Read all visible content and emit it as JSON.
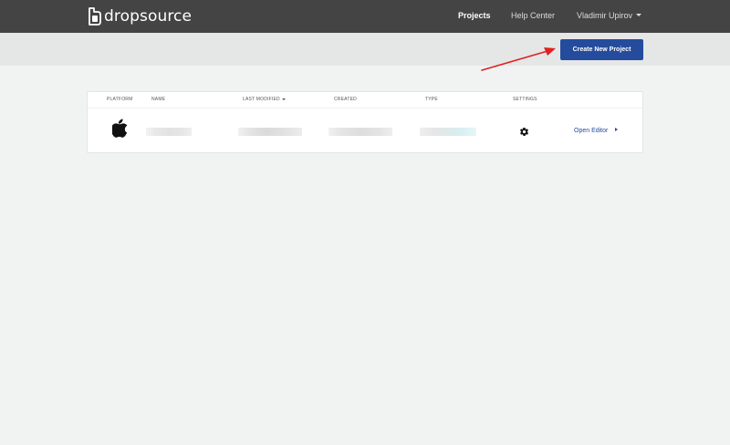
{
  "brand": {
    "name": "dropsource"
  },
  "nav": {
    "projects": "Projects",
    "help_center": "Help Center",
    "user": "Vladimir Upirov"
  },
  "toolbar": {
    "create_label": "Create New Project"
  },
  "table": {
    "headers": {
      "platform": "PLATFORM",
      "name": "NAME",
      "last_modified": "LAST MODIFIED",
      "created": "CREATED",
      "type": "TYPE",
      "settings": "SETTINGS"
    },
    "rows": [
      {
        "platform_icon": "apple-icon",
        "open_editor": "Open Editor"
      }
    ]
  },
  "colors": {
    "topbar": "#444444",
    "accent": "#254b9c",
    "annotation_arrow": "#e02020"
  }
}
